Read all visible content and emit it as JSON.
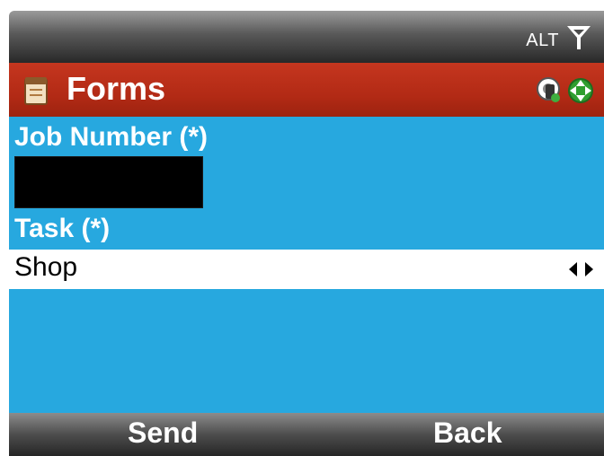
{
  "statusbar": {
    "alt_label": "ALT",
    "signal_icon": "antenna-signal-icon"
  },
  "titlebar": {
    "title": "Forms",
    "app_icon": "forms-app-icon",
    "right_icons": [
      "network-connection-icon",
      "navigation-pad-icon"
    ]
  },
  "form": {
    "job_number_label": "Job Number (*)",
    "job_number_value": "",
    "task_label": "Task (*)",
    "task_value": "Shop"
  },
  "softkeys": {
    "left": "Send",
    "right": "Back"
  },
  "colors": {
    "content_bg": "#27a8df",
    "titlebar_bg": "#b22a15",
    "statusbar_bg": "#4d4d4d"
  }
}
